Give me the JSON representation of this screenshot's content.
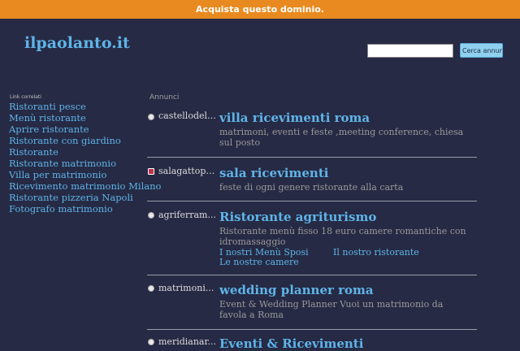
{
  "topbar": {
    "label": "Acquista questo dominio."
  },
  "site": {
    "title": "ilpaolanto.it"
  },
  "search": {
    "placeholder": "",
    "button_label": "Cerca annunci"
  },
  "related": {
    "heading": "Link correlati",
    "items": [
      "Ristoranti pesce",
      "Menù ristorante",
      "Aprire ristorante",
      "Ristorante con giardino",
      "Ristorante",
      "Ristorante matrimonio",
      "Villa per matrimonio",
      "Ricevimento matrimonio Milano",
      "Ristorante pizzeria Napoli",
      "Fotografo matrimonio"
    ]
  },
  "ads": {
    "heading": "Annunci",
    "items": [
      {
        "domain": "castellodell...",
        "title": "villa ricevimenti roma",
        "description": "matrimoni, eventi e feste ,meeting conference, chiesa sul posto",
        "icon": "globe-icon"
      },
      {
        "domain": "salagattopa...",
        "title": "sala ricevimenti",
        "description": "feste di ogni genere ristorante alla carta",
        "icon": "site-favicon"
      },
      {
        "domain": "agriferram...",
        "title": "Ristorante agriturismo",
        "description": "Ristorante menù fisso 18 euro camere romantiche con idromassaggio",
        "icon": "globe-icon",
        "sublinks": [
          "I nostri Menù Sposi",
          "Il nostro ristorante",
          "Le nostre camere"
        ]
      },
      {
        "domain": "matrimoni...",
        "title": "wedding planner roma",
        "description": "Event & Wedding Planner Vuoi un matrimonio da favola a Roma",
        "icon": "globe-icon"
      },
      {
        "domain": "meridianar...",
        "title": "Eventi & Ricevimenti",
        "description": "",
        "icon": "globe-icon"
      }
    ]
  }
}
